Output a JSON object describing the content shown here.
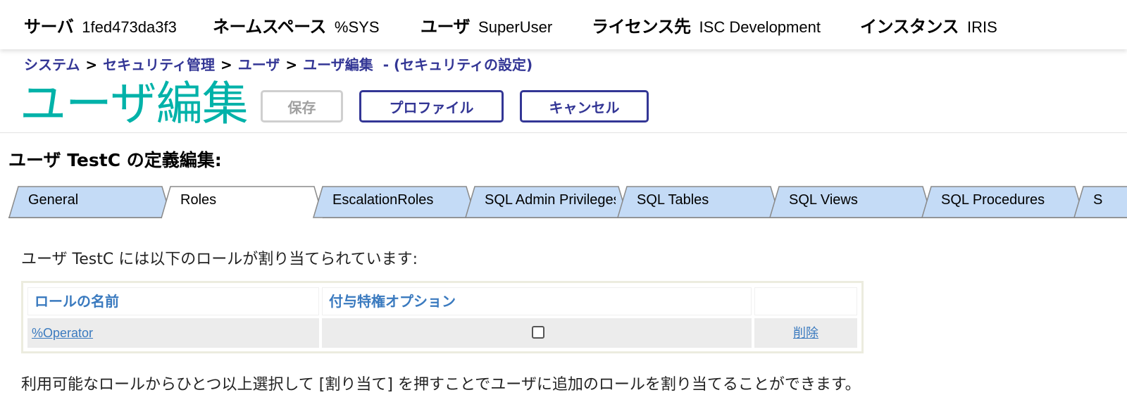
{
  "header": {
    "server_label": "サーバ",
    "server_value": "1fed473da3f3",
    "namespace_label": "ネームスペース",
    "namespace_value": "%SYS",
    "user_label": "ユーザ",
    "user_value": "SuperUser",
    "license_label": "ライセンス先",
    "license_value": "ISC Development",
    "instance_label": "インスタンス",
    "instance_value": "IRIS"
  },
  "breadcrumb": {
    "items": [
      "システム",
      "セキュリティ管理",
      "ユーザ",
      "ユーザ編集"
    ],
    "separator": ">",
    "context": "- (セキュリティの設定)"
  },
  "page": {
    "title": "ユーザ編集",
    "buttons": {
      "save": "保存",
      "profile": "プロファイル",
      "cancel": "キャンセル"
    },
    "definition_heading": "ユーザ TestC の定義編集:"
  },
  "tabs": [
    "General",
    "Roles",
    "EscalationRoles",
    "SQL Admin Privileges",
    "SQL Tables",
    "SQL Views",
    "SQL Procedures",
    "S"
  ],
  "active_tab": "Roles",
  "roles": {
    "assigned_text": "ユーザ TestC には以下のロールが割り当てられています:",
    "columns": [
      "ロールの名前",
      "付与特権オプション",
      ""
    ],
    "rows": [
      {
        "role": "%Operator",
        "grant_option": false,
        "action": "削除"
      }
    ],
    "available_text": "利用可能なロールからひとつ以上選択して [割り当て] を押すことでユーザに追加のロールを割り当てることができます。"
  },
  "colors": {
    "title": "#00b2a9",
    "link": "#333695",
    "tab_inactive": "#c4dbf6",
    "tab_active": "#ffffff",
    "table_link": "#3a7abf"
  }
}
